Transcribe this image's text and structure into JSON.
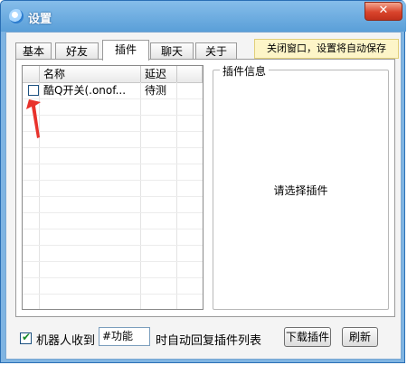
{
  "window": {
    "title": "设置",
    "close_label": "✕"
  },
  "tabs": [
    {
      "label": "基本"
    },
    {
      "label": "好友"
    },
    {
      "label": "插件",
      "active": true
    },
    {
      "label": "聊天"
    },
    {
      "label": "关于"
    }
  ],
  "notice": "关闭窗口，设置将自动保存",
  "plugin_list": {
    "columns": [
      "名称",
      "延迟"
    ],
    "rows": [
      {
        "checked": false,
        "name": "酷Q开关(.onof...",
        "delay": "待测"
      }
    ]
  },
  "info": {
    "group_title": "插件信息",
    "placeholder": "请选择插件"
  },
  "bottom": {
    "checkbox_checked": true,
    "label_before": "机器人收到",
    "keyword_value": "#功能",
    "label_after": "时自动回复插件列表",
    "download_button": "下载插件",
    "refresh_button": "刷新"
  },
  "colors": {
    "title_bar": "#5a9fd8",
    "close_button": "#d9442c",
    "notice_bg": "#fdf5c8",
    "annotation_arrow": "#e8322b"
  }
}
